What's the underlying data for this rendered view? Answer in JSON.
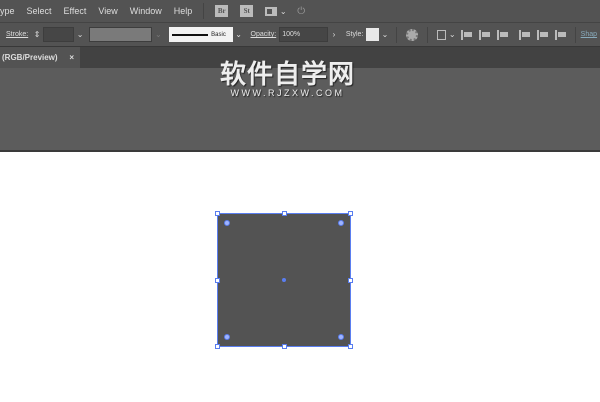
{
  "menubar": {
    "items": [
      "ype",
      "Select",
      "Effect",
      "View",
      "Window",
      "Help"
    ],
    "br": "Br",
    "st": "St"
  },
  "control": {
    "stroke_label": "Stroke:",
    "brush_label": "Basic",
    "opacity_label": "Opacity:",
    "opacity_value": "100%",
    "style_label": "Style:",
    "shape_label": "Shap"
  },
  "tab": {
    "label": "(RGB/Preview)",
    "close": "×"
  },
  "watermark": {
    "cn": "软件自学网",
    "en": "WWW.RJZXW.COM"
  },
  "colors": {
    "selection": "#5a7ef0",
    "shape_fill": "#535353"
  }
}
